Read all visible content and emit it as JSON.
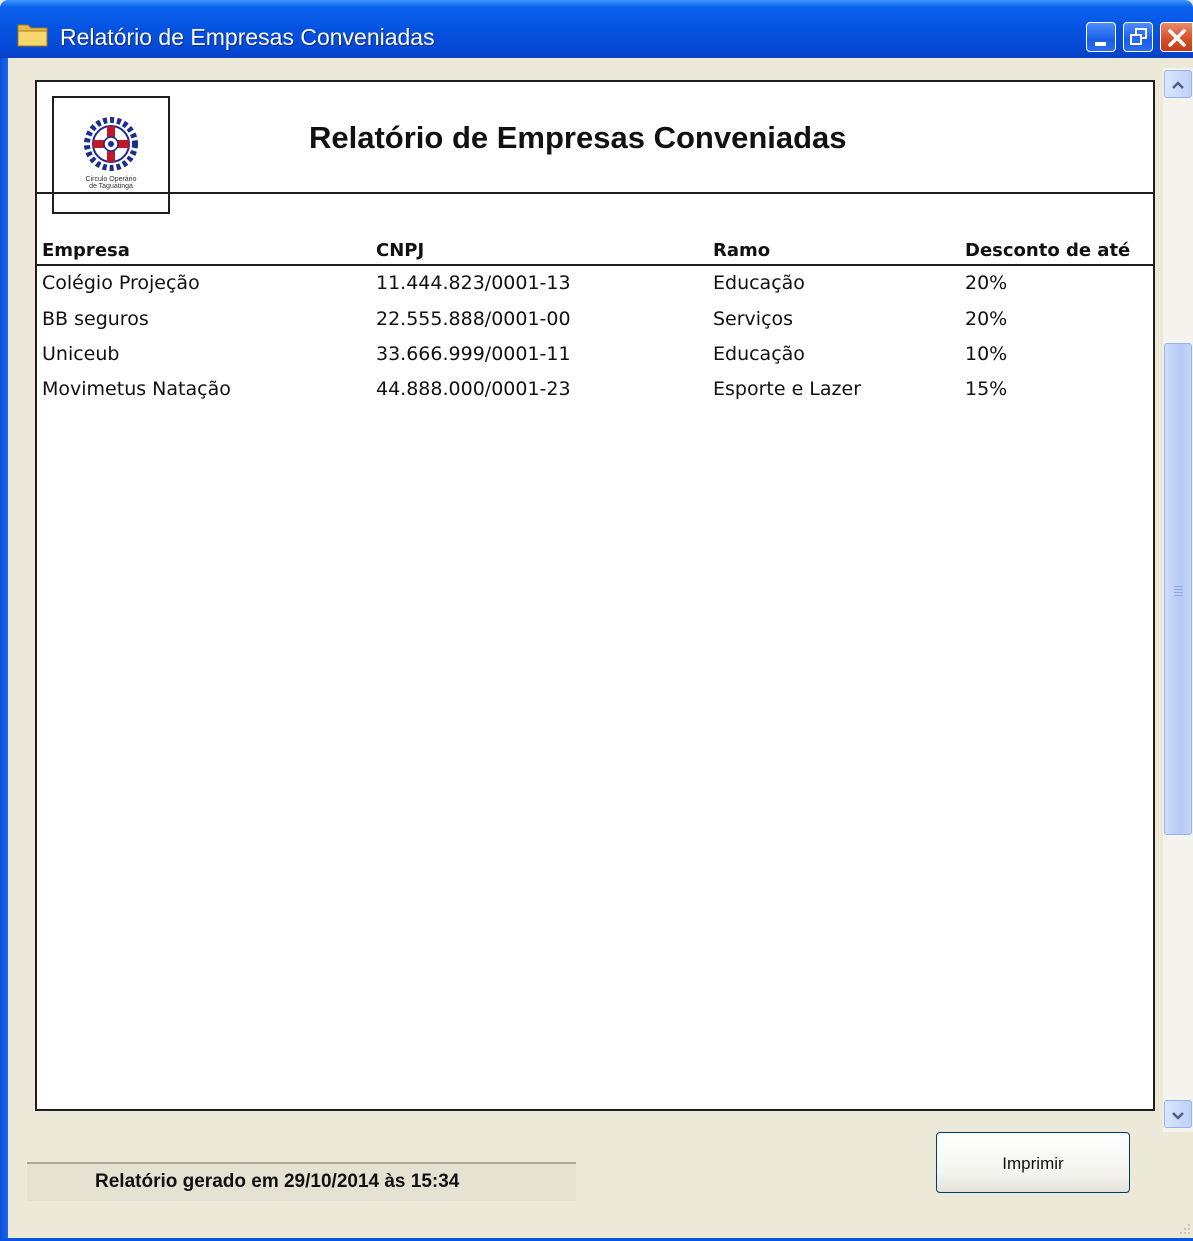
{
  "window": {
    "title": "Relatório de Empresas Conveniadas"
  },
  "icons": {
    "window_icon": "folder-icon",
    "minimize": "minimize-icon",
    "maximize": "restore-icon",
    "close": "close-icon",
    "scroll_up": "chevron-up-icon",
    "scroll_down": "chevron-down-icon"
  },
  "colors": {
    "titlebar": "#0553e0",
    "close_button": "#d8512b",
    "window_bg": "#ece9d8",
    "scroll_accent": "#b6caf6"
  },
  "report": {
    "title": "Relatório de Empresas Conveniadas",
    "logo_caption_line1": "Circulo Operário",
    "logo_caption_line2": "de Taguatinga",
    "columns": [
      "Empresa",
      "CNPJ",
      "Ramo",
      "Desconto de até"
    ],
    "rows": [
      [
        "Colégio Projeção",
        "11.444.823/0001-13",
        "Educação",
        "20%"
      ],
      [
        "BB seguros",
        "22.555.888/0001-00",
        "Serviços",
        "20%"
      ],
      [
        "Uniceub",
        "33.666.999/0001-11",
        "Educação",
        "10%"
      ],
      [
        "Movimetus Natação",
        "44.888.000/0001-23",
        "Esporte e Lazer",
        "15%"
      ]
    ]
  },
  "footer": {
    "status": "Relatório gerado em 29/10/2014 às 15:34",
    "print_button": "Imprimir"
  }
}
